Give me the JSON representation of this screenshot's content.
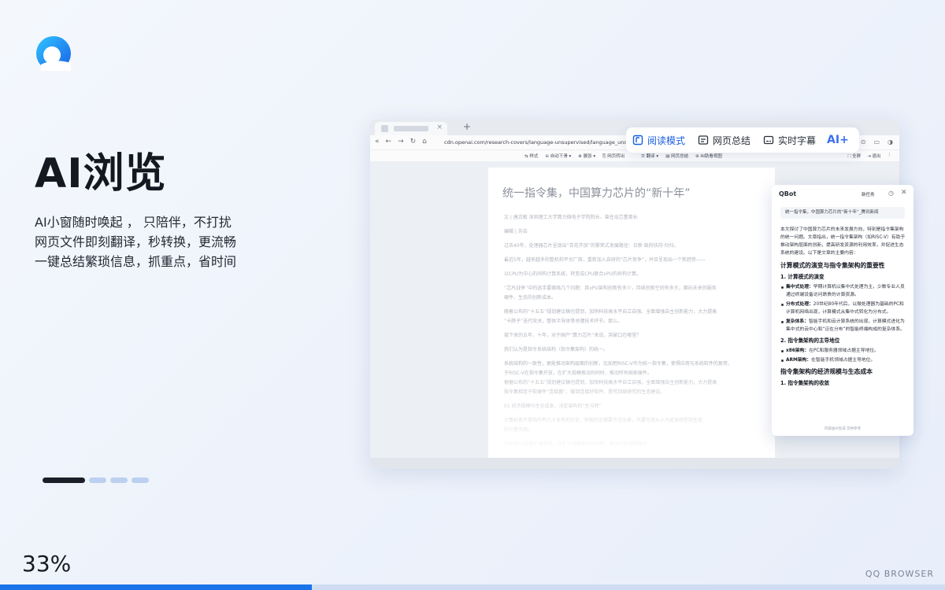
{
  "hero": {
    "headline": "AI浏览",
    "taglines": [
      "AI小窗随时唤起 ， 只陪伴，不打扰",
      "网页文件即刻翻译，秒转换，更流畅",
      "一键总结繁琐信息，抓重点，省时间"
    ]
  },
  "progress": {
    "percent_label": "33%",
    "value": 0.33
  },
  "carousel": {
    "count": 4,
    "active_index": 0
  },
  "brand": "QQ BROWSER",
  "browser": {
    "new_tab": "+",
    "tab_close": "×",
    "url": "cdn.openai.com/research-covers/language-unsupervised/language_understanding_p",
    "subtoolbar": {
      "left": [
        "⇆ 样式",
        "⊖ 自动下滑 ▾",
        "⊕ 展张 ▾",
        "⎘ 网页转出"
      ],
      "middle": [
        "☰ 翻译 ▾",
        "▤ 网页总结",
        "⊛ AI助看视图"
      ],
      "right": [
        "⛶ 全屏",
        "⇥ 退出",
        "⋮"
      ]
    },
    "modes": [
      {
        "label": "阅读模式",
        "icon": "book-reader-icon",
        "active": true
      },
      {
        "label": "网页总结",
        "icon": "summary-icon",
        "active": false
      },
      {
        "label": "实时字幕",
        "icon": "subtitle-icon",
        "active": false
      }
    ],
    "ai_mode": "AI+"
  },
  "document": {
    "title": "统一指令集，中国算力芯片的“新十年”",
    "lines": [
      "文 | 唐志敏 深圳理工大学算力微电子学院院长、曾任龙芯董事长",
      "编辑 | 苏告",
      "过去40年，处理器芯片呈现出“百花齐放”的繁荣式发展路径：日新·政府扶持·扫扫。",
      "最近5年，越来越多的整机和平台厂商，重新加入自研的“芯片竞争”，并且呈现出一个新趋势——",
      "以CPU为中心的同构计算系统，转变成CPU联合xPU的异构计算。",
      "“芯片战争”中的选手要面临几个问题：其xPU架构创新有多少，持续创新空间有多大，面向未来的服务",
      "硬件、生态的创新成本。",
      "随着公布的“十五五”规划建议稿也提到，加快科技高水平自立自强，全面增强自主创新能力，大力提高",
      "“卡脖子”迭代攻关，整体半导体等关键技术环节。那么，",
      "接下来的五年、十年，对于国产“算力芯片”来说，突破口在哪里？",
      "我们认为是指令系统结构（指令集架构）的统一。",
      "系统结构的一致性，更能推动架构层面的创新，比如把RISC-V作为统一指令集，使得应用与系统软件的复用，",
      "于RISC-V在指令集开放，在扩大规模推动的同时，推动所有国家硬件。",
      "根据公布的“十五五”规划建议稿也提到，加快科技高水平自立自强，全面增强自主创新能力，大力提高",
      "指令集相连于软硬件“连接器”，做到连接好软件，是可持续研究的生态建设。",
      "01 经济规模与生态成本，决定架构的“生与死”",
      "计算机者不单纯只有几十多年的历史，纵观历史需要不过全景，只要可用从人力成本转型到生态",
      "的计算资源。",
      "于RISC-V这类扩展开放，在扩大规模推动的同时，推动所有国家硬件。"
    ]
  },
  "qbot": {
    "title": "QBot",
    "new_chat": "新任务",
    "ref_title": "统一指令集，中国算力芯片的“新十年”_腾讯新闻",
    "intro": "本文探讨了中国算力芯片的未来发展方向，特别是指令集架构的统一问题。文章指出，统一指令集架构（如RISC-V）有助于推动架构层面的创新，提高研发资源的利用效率，并促进生态系统的建设。以下是文章的主要内容：",
    "section1": "计算模式的演变与指令集架构的重要性",
    "sub1": "1. 计算模式的演变",
    "items1": [
      {
        "term": "集中式处理：",
        "text": "早期计算机以集中式处理为主，少数专业人员通过终端设备访问昂贵的计算资源。"
      },
      {
        "term": "分布式处理：",
        "text": "20世纪80年代后，以微处理器为基础的PC和计算机网络出现，计算模式从集中式转化为分布式。"
      },
      {
        "term": "复杂体系：",
        "text": "智能手机和云计算系统的出现，计算模式进化为集中式的云中心和“泛在分布”的智能终端构成的复杂体系。"
      }
    ],
    "sub2": "2. 指令集架构的主导地位",
    "items2": [
      {
        "term": "x86架构：",
        "text": "在PC和服务器领域占据主导地位。"
      },
      {
        "term": "ARM架构：",
        "text": "在智能手机领域占据主导地位。"
      }
    ],
    "section2": "指令集架构的经济规模与生态成本",
    "sub3": "1. 指令集架构的收敛",
    "footer": "内容由AI生成 仅供参考"
  }
}
